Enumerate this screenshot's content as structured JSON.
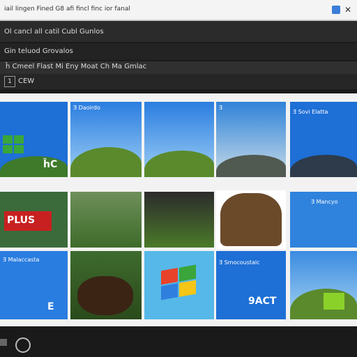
{
  "window": {
    "title": "iail Iingen Fined G8 afi fincl finc ior fanal"
  },
  "rows": {
    "r1": "Ol cancl all catil Cubl Gunlos",
    "r2": "Gin teluod Grovalos",
    "r3": "ĥ Cmeel Flast Mi Eny Moat Ch Ma Gmlac",
    "r4_label": "CEW",
    "r4_box": "1"
  },
  "tiles": [
    {
      "caption": "",
      "big": "ĥC"
    },
    {
      "caption": "Ǝ Daoirdo",
      "big": ""
    },
    {
      "caption": "",
      "big": ""
    },
    {
      "caption": "Ǝ",
      "big": ""
    },
    {
      "caption": "Ǝ Sovi Elatta",
      "big": ""
    },
    {
      "caption": "",
      "big": "PLUS"
    },
    {
      "caption": "",
      "big": ""
    },
    {
      "caption": "",
      "big": ""
    },
    {
      "caption": "",
      "big": ""
    },
    {
      "caption": "Ǝ Mancyo",
      "big": ""
    },
    {
      "caption": "Ǝ Malaccasta",
      "big": "E"
    },
    {
      "caption": "",
      "big": ""
    },
    {
      "caption": "",
      "big": ""
    },
    {
      "caption": "Ǝ Smocoustalc",
      "big": "9ACT"
    },
    {
      "caption": "",
      "big": ""
    }
  ],
  "colors": {
    "accent": "#1e6fd6",
    "bg_dark": "#1b1b1b",
    "grass": "#5b8a2c"
  },
  "icons": {
    "close": "x-icon",
    "app": "app-icon"
  }
}
